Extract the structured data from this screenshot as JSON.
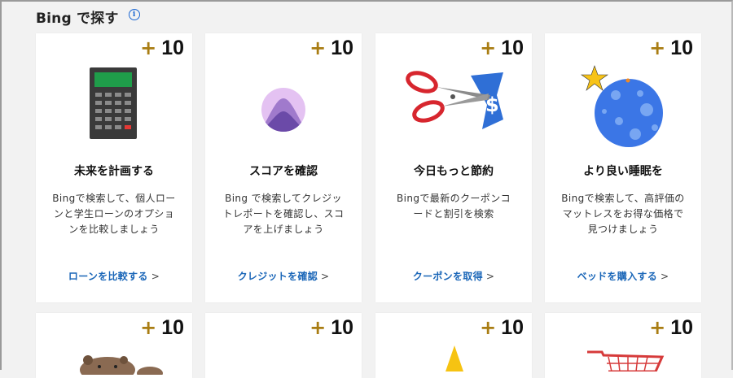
{
  "section": {
    "title": "Bing で探す",
    "info_icon": "info-icon"
  },
  "colors": {
    "points_plus": "#a97d13",
    "link": "#1a66b8",
    "background": "#f2f2f2",
    "card": "#ffffff"
  },
  "cards_row1": [
    {
      "plus": "+",
      "points": "10",
      "icon": "calculator-icon",
      "title": "未来を計画する",
      "desc": "Bingで検索して、個人ローンと学生ローンのオプションを比較しましょう",
      "link": "ローンを比較する",
      "chevron": ">"
    },
    {
      "plus": "+",
      "points": "10",
      "icon": "mountain-circle-icon",
      "title": "スコアを確認",
      "desc": "Bing で検索してクレジットレポートを確認し、スコアを上げましょう",
      "link": "クレジットを確認",
      "chevron": ">"
    },
    {
      "plus": "+",
      "points": "10",
      "icon": "scissors-coupon-icon",
      "title": "今日もっと節約",
      "desc": "Bingで最新のクーポンコードと割引を検索",
      "link": "クーポンを取得",
      "chevron": ">"
    },
    {
      "plus": "+",
      "points": "10",
      "icon": "moon-star-icon",
      "title": "より良い睡眠を",
      "desc": "Bingで検索して、高評価のマットレスをお得な価格で見つけましょう",
      "link": "ベッドを購入する",
      "chevron": ">"
    }
  ],
  "cards_row2": [
    {
      "plus": "+",
      "points": "10",
      "icon": "bear-icon"
    },
    {
      "plus": "+",
      "points": "10",
      "icon": "blank"
    },
    {
      "plus": "+",
      "points": "10",
      "icon": "cone-icon"
    },
    {
      "plus": "+",
      "points": "10",
      "icon": "shopping-cart-icon"
    }
  ]
}
